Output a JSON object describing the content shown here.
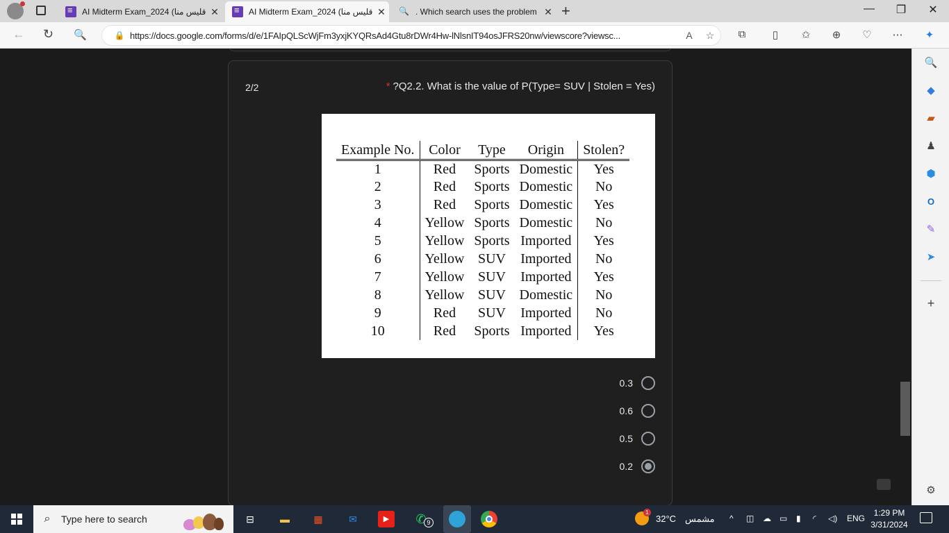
{
  "browser": {
    "tabs": [
      {
        "title": "AI Midterm Exam_2024 (قليس منا",
        "active": false
      },
      {
        "title": "AI Midterm Exam_2024 (قليس منا",
        "active": true
      },
      {
        "title": ". Which search uses the problem",
        "active": false
      }
    ],
    "url": "https://docs.google.com/forms/d/e/1FAIpQLScWjFm3yxjKYQRsAd4Gtu8rDWr4Hw-lNlsnIT94osJFRS20nw/viewscore?viewsc..."
  },
  "question": {
    "score": "2/2",
    "required_mark": "*",
    "text": "?Q2.2. What is the value of P(Type= SUV | Stolen = Yes)",
    "table": {
      "headers": [
        "Example No.",
        "Color",
        "Type",
        "Origin",
        "Stolen?"
      ],
      "rows": [
        [
          "1",
          "Red",
          "Sports",
          "Domestic",
          "Yes"
        ],
        [
          "2",
          "Red",
          "Sports",
          "Domestic",
          "No"
        ],
        [
          "3",
          "Red",
          "Sports",
          "Domestic",
          "Yes"
        ],
        [
          "4",
          "Yellow",
          "Sports",
          "Domestic",
          "No"
        ],
        [
          "5",
          "Yellow",
          "Sports",
          "Imported",
          "Yes"
        ],
        [
          "6",
          "Yellow",
          "SUV",
          "Imported",
          "No"
        ],
        [
          "7",
          "Yellow",
          "SUV",
          "Imported",
          "Yes"
        ],
        [
          "8",
          "Yellow",
          "SUV",
          "Domestic",
          "No"
        ],
        [
          "9",
          "Red",
          "SUV",
          "Imported",
          "No"
        ],
        [
          "10",
          "Red",
          "Sports",
          "Imported",
          "Yes"
        ]
      ]
    },
    "options": [
      {
        "label": "0.3",
        "selected": false
      },
      {
        "label": "0.6",
        "selected": false
      },
      {
        "label": "0.5",
        "selected": false
      },
      {
        "label": "0.2",
        "selected": true
      }
    ]
  },
  "taskbar": {
    "search_placeholder": "Type here to search",
    "whatsapp_badge": "9",
    "weather_badge": "1",
    "weather": "32°C",
    "weather_desc": "مشمس",
    "language": "ENG",
    "time": "1:29 PM",
    "date": "3/31/2024"
  },
  "icons": {
    "tab_favicon": "google-forms-icon",
    "search_tab_favicon": "search-icon",
    "back": "arrow-left-icon",
    "refresh": "refresh-icon",
    "lock": "lock-icon"
  }
}
